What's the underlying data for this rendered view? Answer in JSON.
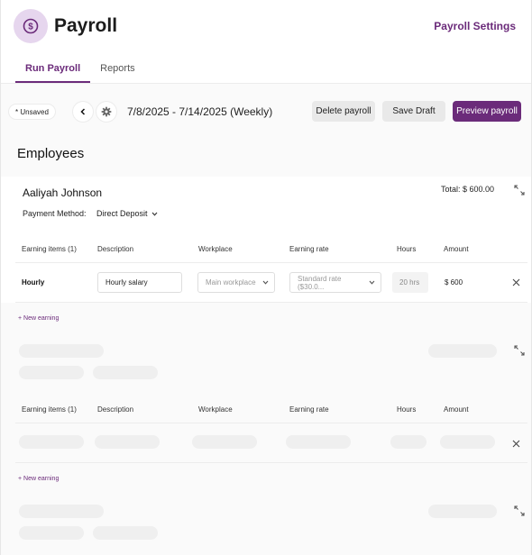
{
  "header": {
    "title": "Payroll",
    "settings_link": "Payroll Settings",
    "tabs": [
      {
        "label": "Run Payroll",
        "active": true
      },
      {
        "label": "Reports",
        "active": false
      }
    ]
  },
  "toolbar": {
    "status_badge": "* Unsaved",
    "date_range": "7/8/2025 - 7/14/2025 (Weekly)",
    "delete_label": "Delete payroll",
    "save_label": "Save Draft",
    "preview_label": "Preview payroll"
  },
  "employees_section": {
    "title": "Employees"
  },
  "employee": {
    "name": "Aaliyah Johnson",
    "total": "Total: $ 600.00",
    "payment_method_label": "Payment Method:",
    "payment_method_value": "Direct Deposit",
    "columns": [
      "Earning items (1)",
      "Description",
      "Workplace",
      "Earning rate",
      "Hours",
      "Amount"
    ],
    "earning": {
      "type": "Hourly",
      "description": "Hourly salary",
      "workplace_placeholder": "Main workplace",
      "rate_placeholder": "Standard rate ($30.0...",
      "hours_placeholder": "20 hrs",
      "amount": "$ 600"
    },
    "new_earning_label": "+ New earning"
  },
  "loading_employee": {
    "columns": [
      "Earning items (1)",
      "Description",
      "Workplace",
      "Earning rate",
      "Hours",
      "Amount"
    ],
    "new_earning_label": "+ New earning"
  },
  "colors": {
    "accent": "#6b2b7a",
    "accent_light": "#e6d6ee"
  }
}
